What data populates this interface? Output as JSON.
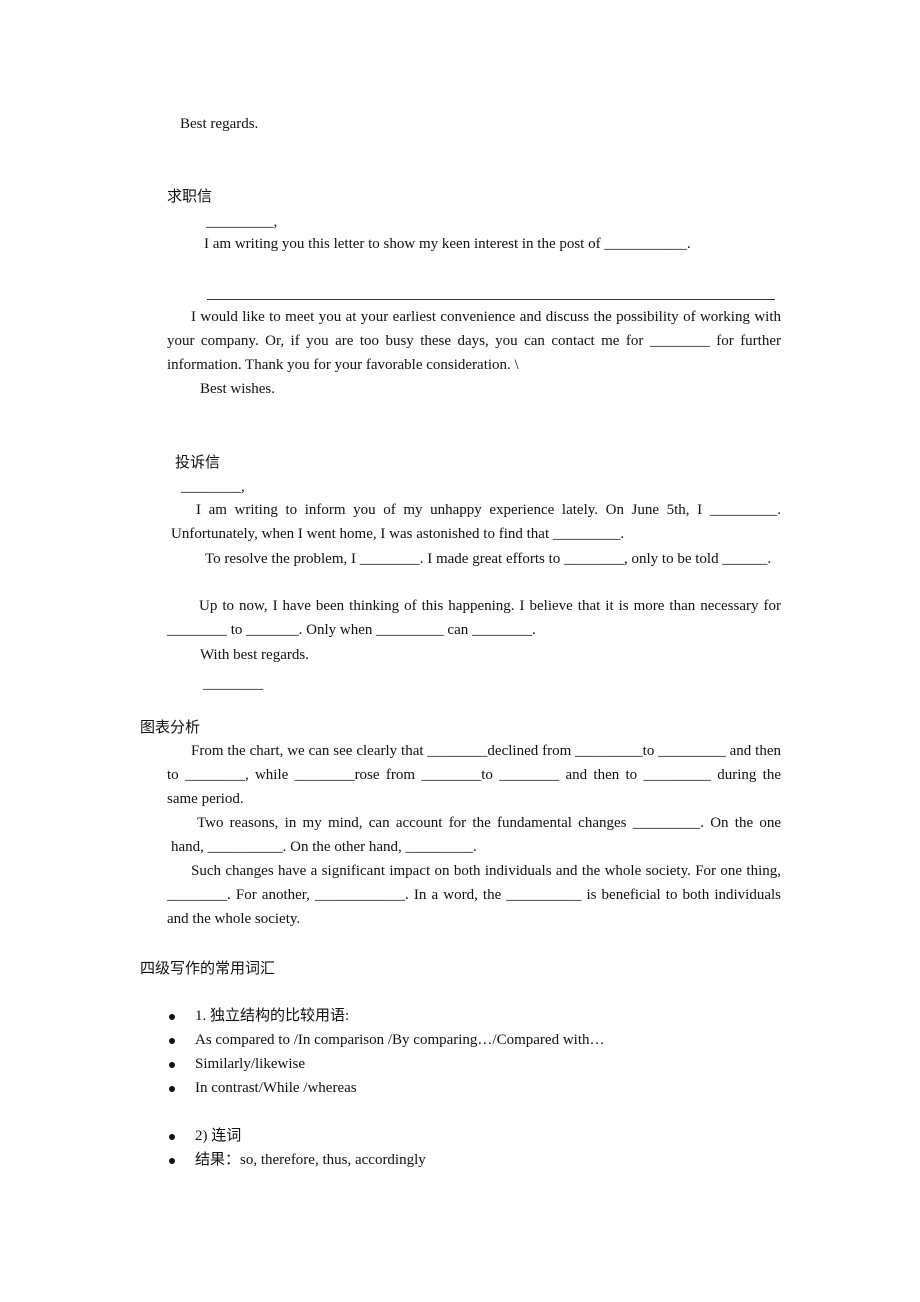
{
  "top": {
    "closing": "Best regards."
  },
  "job_letter": {
    "title": "求职信",
    "salutation": "_________,",
    "line1": "I am writing you this letter to show my keen interest in the post of ___________.",
    "para2": "I would like to meet you at your earliest convenience and discuss the possibility of working with your company. Or, if you are too busy these days, you can contact me for ________ for further information. Thank you for your favorable consideration. \\",
    "closing": "Best wishes."
  },
  "complaint_letter": {
    "title": "投诉信",
    "salutation": "________,",
    "para1": "I am writing to inform you of my unhappy experience lately. On June 5th, I _________. Unfortunately, when I went home, I was astonished to find that _________.",
    "para2": "To resolve the problem, I ________. I made great efforts to ________, only to be told ______.",
    "para3": "Up to now, I have been thinking of this happening. I believe that it is more than necessary for ________ to _______. Only when _________ can ________.",
    "closing": "With best regards.",
    "signature": "________"
  },
  "chart_analysis": {
    "title": "图表分析",
    "para1": "From the chart, we can see clearly that ________declined from _________to _________ and then to ________, while ________rose from ________to ________ and then to _________ during the same period.",
    "para2": "Two reasons, in my mind, can account for the fundamental changes _________. On the one hand, __________. On the other hand, _________.",
    "para3": "Such changes have a significant impact on both individuals and the whole society. For one thing, ________. For another, ____________. In a word, the __________ is beneficial to both individuals and the whole society."
  },
  "vocabulary": {
    "title": "四级写作的常用词汇",
    "group1": [
      "1.  独立结构的比较用语:",
      "As compared to /In comparison /By comparing…/Compared with…",
      "Similarly/likewise",
      "In contrast/While /whereas"
    ],
    "group2": [
      "2)  连词",
      "结果：so, therefore, thus, accordingly"
    ]
  }
}
